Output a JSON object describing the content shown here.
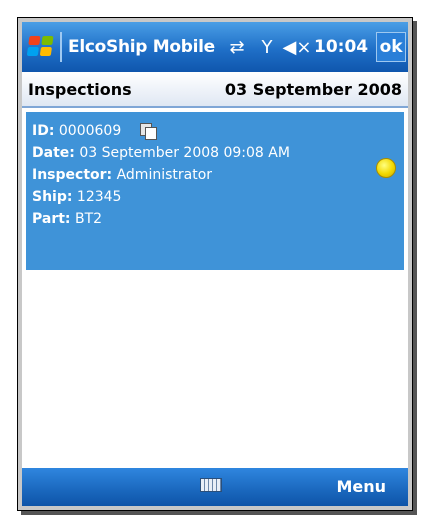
{
  "titlebar": {
    "app_title": "ElcoShip Mobile",
    "time": "10:04",
    "ok_label": "ok"
  },
  "header": {
    "title": "Inspections",
    "date": "03 September 2008"
  },
  "inspection": {
    "id_label": "ID:",
    "id_value": "0000609",
    "date_label": "Date:",
    "date_value": "03 September 2008 09:08 AM",
    "inspector_label": "Inspector:",
    "inspector_value": "Administrator",
    "ship_label": "Ship:",
    "ship_value": "12345",
    "part_label": "Part:",
    "part_value": "BT2",
    "status_color": "#f2d800"
  },
  "menubar": {
    "menu_label": "Menu"
  },
  "icons": [
    "start-flag-icon",
    "connectivity-icon",
    "signal-icon",
    "volume-muted-icon",
    "copy-icon",
    "status-dot-icon",
    "keyboard-icon"
  ],
  "colors": {
    "title_blue": "#1f6fc7",
    "selection_blue": "#3f93d8"
  }
}
